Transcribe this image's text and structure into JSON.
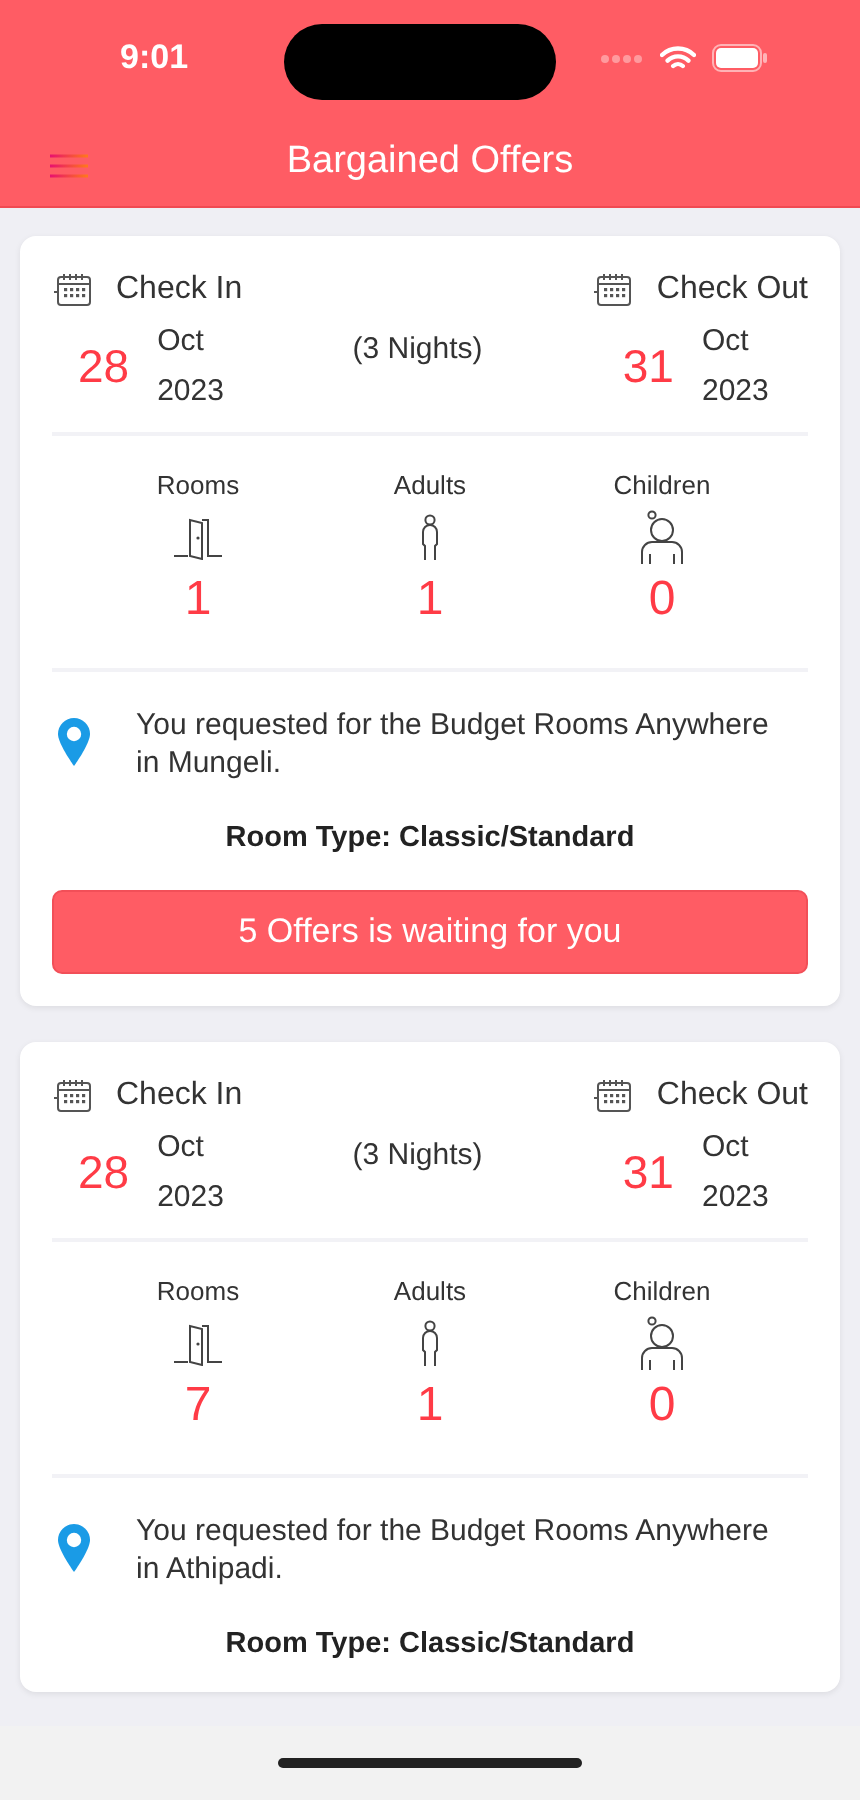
{
  "status_bar": {
    "time": "9:01"
  },
  "nav": {
    "title": "Bargained Offers"
  },
  "bookings": [
    {
      "check_in": {
        "label": "Check In",
        "day": "28",
        "month": "Oct",
        "year": "2023"
      },
      "nights": "(3 Nights)",
      "check_out": {
        "label": "Check Out",
        "day": "31",
        "month": "Oct",
        "year": "2023"
      },
      "counts": [
        {
          "kind": "rooms",
          "label": "Rooms",
          "value": "1"
        },
        {
          "kind": "adults",
          "label": "Adults",
          "value": "1"
        },
        {
          "kind": "children",
          "label": "Children",
          "value": "0"
        }
      ],
      "request": "You requested for the Budget Rooms Anywhere in Mungeli.",
      "room_type": "Room Type: Classic/Standard",
      "offers_button": "5 Offers is waiting for you"
    },
    {
      "check_in": {
        "label": "Check In",
        "day": "28",
        "month": "Oct",
        "year": "2023"
      },
      "nights": "(3 Nights)",
      "check_out": {
        "label": "Check Out",
        "day": "31",
        "month": "Oct",
        "year": "2023"
      },
      "counts": [
        {
          "kind": "rooms",
          "label": "Rooms",
          "value": "7"
        },
        {
          "kind": "adults",
          "label": "Adults",
          "value": "1"
        },
        {
          "kind": "children",
          "label": "Children",
          "value": "0"
        }
      ],
      "request": "You requested for the Budget Rooms Anywhere in Athipadi.",
      "room_type": "Room Type: Classic/Standard"
    }
  ]
}
